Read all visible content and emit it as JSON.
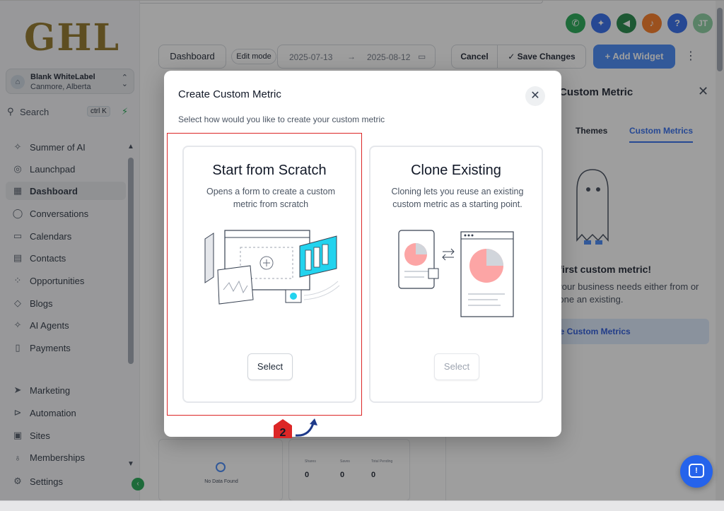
{
  "sidebar": {
    "logo": "GHL",
    "account": {
      "name": "Blank WhiteLabel",
      "location": "Canmore, Alberta"
    },
    "search": {
      "label": "Search",
      "shortcut": "ctrl K"
    },
    "items": [
      {
        "label": "Summer of AI",
        "icon": "sparkle-icon"
      },
      {
        "label": "Launchpad",
        "icon": "rocket-icon"
      },
      {
        "label": "Dashboard",
        "icon": "grid-icon"
      },
      {
        "label": "Conversations",
        "icon": "chat-icon"
      },
      {
        "label": "Calendars",
        "icon": "calendar-icon"
      },
      {
        "label": "Contacts",
        "icon": "contacts-icon"
      },
      {
        "label": "Opportunities",
        "icon": "funnel-icon"
      },
      {
        "label": "Blogs",
        "icon": "cube-icon"
      },
      {
        "label": "AI Agents",
        "icon": "sparkle-icon"
      },
      {
        "label": "Payments",
        "icon": "receipt-icon"
      },
      {
        "label": "Marketing",
        "icon": "send-icon"
      },
      {
        "label": "Automation",
        "icon": "automation-icon"
      },
      {
        "label": "Sites",
        "icon": "sites-icon"
      },
      {
        "label": "Memberships",
        "icon": "award-icon"
      },
      {
        "label": "Settings",
        "icon": "gear-icon"
      }
    ]
  },
  "header": {
    "avatar_initials": "JT",
    "help_label": "?"
  },
  "toolbar": {
    "dashboard_label": "Dashboard",
    "edit_mode_label": "Edit mode",
    "date_start": "2025-07-13",
    "date_end": "2025-08-12",
    "cancel_label": "Cancel",
    "save_label": "Save Changes",
    "add_widget_label": "Add Widget"
  },
  "right_panel": {
    "title": "Custom Metric",
    "tabs": [
      "Themes",
      "Custom Metrics"
    ],
    "heading": "r first custom metric!",
    "description": "t your business needs either from or clone an existing.",
    "button_label": "ate Custom Metrics"
  },
  "widgets": {
    "no_data": "No Data Found",
    "stats": [
      {
        "label": "Shares",
        "value": "0"
      },
      {
        "label": "Saves",
        "value": "0"
      },
      {
        "label": "Total Pending",
        "value": "0"
      }
    ]
  },
  "modal": {
    "title": "Create Custom Metric",
    "subtitle": "Select how would you like to create your custom metric",
    "cards": [
      {
        "title": "Start from Scratch",
        "description": "Opens a form to create a custom metric from scratch",
        "button_label": "Select",
        "enabled": true
      },
      {
        "title": "Clone Existing",
        "description": "Cloning lets you reuse an existing custom metric as a starting point.",
        "button_label": "Select",
        "enabled": false
      }
    ],
    "step_number": "2"
  },
  "colors": {
    "primary": "#3b82f6",
    "highlight": "#dc2626",
    "accent_cyan": "#22d3ee",
    "pie_red": "#fca5a5"
  }
}
